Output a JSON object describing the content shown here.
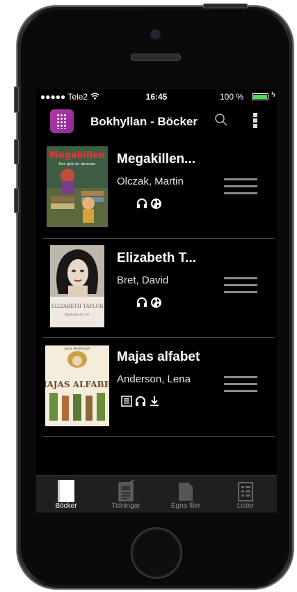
{
  "status_bar": {
    "carrier": "●●●●● Tele2",
    "time": "16:45",
    "battery": "100 %"
  },
  "header": {
    "title": "Bokhyllan - Böcker"
  },
  "books": [
    {
      "title": "Megakillen...",
      "author": "Olczak, Martin",
      "icons": [
        "headphones-icon",
        "globe-icon"
      ]
    },
    {
      "title": "Elizabeth T...",
      "author": "Bret, David",
      "icons": [
        "headphones-icon",
        "globe-icon"
      ]
    },
    {
      "title": "Majas alfabet",
      "author": "Anderson, Lena",
      "icons": [
        "text-icon",
        "headphones-icon",
        "download-icon"
      ]
    }
  ],
  "covers": [
    {
      "title": "Megakillen",
      "subtitle": "Den gick du dessuter"
    },
    {
      "title": "ELIZABETH TAYLOR",
      "subtitle": "Igenom ett liv"
    },
    {
      "title": "MAJAS ALFABET",
      "author": "Lena Anderson"
    }
  ],
  "tabs": [
    {
      "label": "Böcker",
      "active": true
    },
    {
      "label": "Tidningar",
      "active": false
    },
    {
      "label": "Egna filer",
      "active": false
    },
    {
      "label": "Listor",
      "active": false
    }
  ],
  "colors": {
    "accent": "#b23aa3",
    "battery": "#4cd964",
    "tab_bar": "#1f1f1f"
  }
}
